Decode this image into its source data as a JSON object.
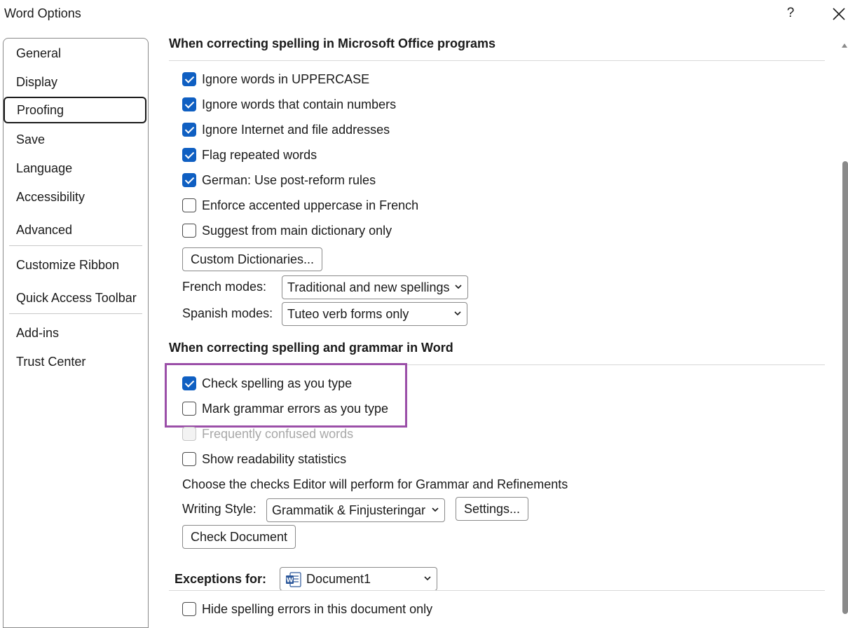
{
  "window": {
    "title": "Word Options",
    "help_label": "?"
  },
  "colors": {
    "accent": "#0f5fc2",
    "highlight": "#9b4fa8"
  },
  "sidebar": {
    "items": [
      {
        "label": "General"
      },
      {
        "label": "Display"
      },
      {
        "label": "Proofing",
        "selected": true
      },
      {
        "label": "Save"
      },
      {
        "label": "Language"
      },
      {
        "label": "Accessibility"
      },
      {
        "label": "Advanced"
      },
      {
        "label": "Customize Ribbon"
      },
      {
        "label": "Quick Access Toolbar"
      },
      {
        "label": "Add-ins"
      },
      {
        "label": "Trust Center"
      }
    ]
  },
  "office_section": {
    "heading": "When correcting spelling in Microsoft Office programs",
    "options": [
      {
        "label": "Ignore words in UPPERCASE",
        "checked": true
      },
      {
        "label": "Ignore words that contain numbers",
        "checked": true
      },
      {
        "label": "Ignore Internet and file addresses",
        "checked": true
      },
      {
        "label": "Flag repeated words",
        "checked": true
      },
      {
        "label": "German: Use post-reform rules",
        "checked": true
      },
      {
        "label": "Enforce accented uppercase in French",
        "checked": false
      },
      {
        "label": "Suggest from main dictionary only",
        "checked": false
      }
    ],
    "custom_dictionaries_button": "Custom Dictionaries...",
    "french_modes_label": "French modes:",
    "french_modes_value": "Traditional and new spellings",
    "spanish_modes_label": "Spanish modes:",
    "spanish_modes_value": "Tuteo verb forms only"
  },
  "word_section": {
    "heading": "When correcting spelling and grammar in Word",
    "options": [
      {
        "label": "Check spelling as you type",
        "checked": true
      },
      {
        "label": "Mark grammar errors as you type",
        "checked": false
      },
      {
        "label": "Frequently confused words",
        "checked": false,
        "disabled": true
      },
      {
        "label": "Show readability statistics",
        "checked": false
      }
    ],
    "editor_checks_text": "Choose the checks Editor will perform for Grammar and Refinements",
    "writing_style_label": "Writing Style:",
    "writing_style_value": "Grammatik & Finjusteringar",
    "settings_button": "Settings...",
    "check_document_button": "Check Document"
  },
  "exceptions_section": {
    "label": "Exceptions for:",
    "document_value": "Document1",
    "document_icon": "word-document-icon",
    "options": [
      {
        "label": "Hide spelling errors in this document only",
        "checked": false
      }
    ]
  }
}
